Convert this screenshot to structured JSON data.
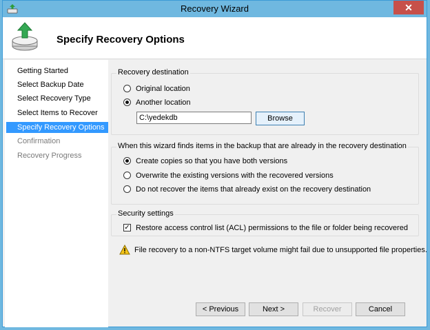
{
  "window": {
    "title": "Recovery Wizard",
    "close_glyph": "✕"
  },
  "header": {
    "title": "Specify Recovery Options"
  },
  "sidebar": {
    "steps": [
      {
        "label": "Getting Started",
        "state": "done"
      },
      {
        "label": "Select Backup Date",
        "state": "done"
      },
      {
        "label": "Select Recovery Type",
        "state": "done"
      },
      {
        "label": "Select Items to Recover",
        "state": "done"
      },
      {
        "label": "Specify Recovery Options",
        "state": "active"
      },
      {
        "label": "Confirmation",
        "state": "disabled"
      },
      {
        "label": "Recovery Progress",
        "state": "disabled"
      }
    ]
  },
  "destination": {
    "group_label": "Recovery destination",
    "original_label": "Original location",
    "another_label": "Another location",
    "selected": "another",
    "path_value": "C:\\yedekdb",
    "browse_label": "Browse"
  },
  "conflict": {
    "group_label": "When this wizard finds items in the backup that are already in the recovery destination",
    "options": [
      {
        "label": "Create copies so that you have both versions",
        "checked": true
      },
      {
        "label": "Overwrite the existing versions with the recovered versions",
        "checked": false
      },
      {
        "label": "Do not recover the items that already exist on the recovery destination",
        "checked": false
      }
    ]
  },
  "security": {
    "group_label": "Security settings",
    "acl_label": "Restore access control list (ACL) permissions to the file or folder being recovered",
    "acl_checked": true
  },
  "warning": {
    "text": "File recovery to a non-NTFS target volume might fail due to unsupported file properties."
  },
  "buttons": {
    "previous": "< Previous",
    "next": "Next >",
    "recover": "Recover",
    "cancel": "Cancel"
  },
  "colors": {
    "accent": "#3399ff",
    "titlebar": "#6fb8e0",
    "close": "#c7504a"
  },
  "icons": {
    "app": "recovery-app-icon",
    "header": "recovery-disk-icon",
    "warning": "warning-triangle-icon"
  }
}
